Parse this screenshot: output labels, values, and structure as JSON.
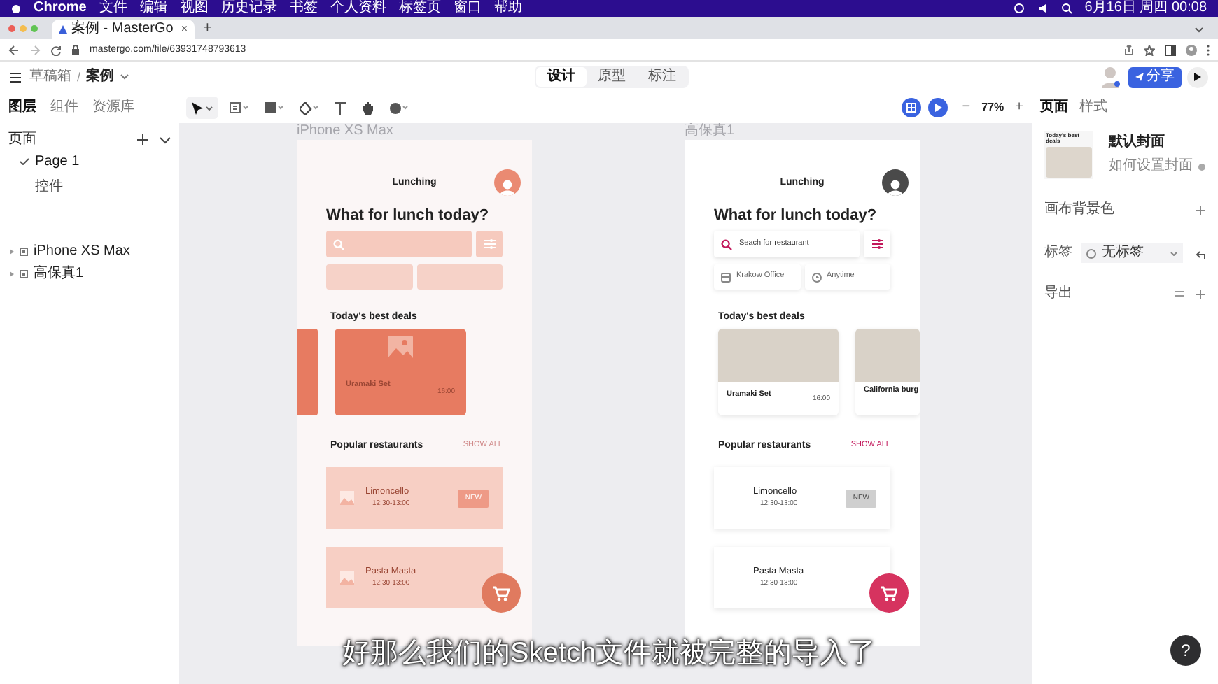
{
  "menubar": {
    "items": [
      "Chrome",
      "文件",
      "编辑",
      "视图",
      "历史记录",
      "书签",
      "个人资料",
      "标签页",
      "窗口",
      "帮助"
    ],
    "clock": "6月16日 周四 00:08"
  },
  "browser": {
    "tab_title": "案例 - MasterGo",
    "tab_close": "×",
    "new_tab": "+",
    "url": "mastergo.com/file/63931748793613"
  },
  "app_header": {
    "breadcrumb": [
      "草稿箱",
      "案例"
    ],
    "separator": "/",
    "modes": [
      {
        "label": "设计",
        "selected": true
      },
      {
        "label": "原型",
        "selected": false
      },
      {
        "label": "标注",
        "selected": false
      }
    ],
    "share": "分享"
  },
  "left_tabs": [
    {
      "label": "图层",
      "selected": true
    },
    {
      "label": "组件",
      "selected": false
    },
    {
      "label": "资源库",
      "selected": false
    }
  ],
  "zoom": {
    "minus": "−",
    "value": "77%",
    "plus": "+"
  },
  "right_tabs": [
    {
      "label": "页面",
      "selected": true
    },
    {
      "label": "样式",
      "selected": false
    }
  ],
  "pages": {
    "title": "页面",
    "items": [
      {
        "label": "Page 1",
        "selected": true
      },
      {
        "label": "控件",
        "selected": false
      }
    ]
  },
  "layers": [
    {
      "label": "iPhone XS Max"
    },
    {
      "label": "高保真1"
    }
  ],
  "frames": [
    {
      "label": "iPhone XS Max",
      "kind": "wireframe",
      "app_title": "Lunching",
      "heading": "What for lunch today?",
      "deals_title": "Today's best deals",
      "deals": [
        {
          "name": "Uramaki Set",
          "time": "16:00"
        }
      ],
      "popular_title": "Popular restaurants",
      "show_all": "SHOW ALL",
      "restaurants": [
        {
          "name": "Limoncello",
          "hours": "12:30-13:00",
          "badge": "NEW"
        },
        {
          "name": "Pasta Masta",
          "hours": "12:30-13:00"
        }
      ]
    },
    {
      "label": "高保真1",
      "kind": "hifi",
      "app_title": "Lunching",
      "heading": "What for lunch today?",
      "search_placeholder": "Seach for restaurant",
      "chips": [
        "Krakow Office",
        "Anytime"
      ],
      "deals_title": "Today's best deals",
      "deals": [
        {
          "name": "Uramaki Set",
          "time": "16:00"
        },
        {
          "name": "California burg"
        }
      ],
      "popular_title": "Popular restaurants",
      "show_all": "SHOW ALL",
      "restaurants": [
        {
          "name": "Limoncello",
          "hours": "12:30-13:00",
          "badge": "NEW"
        },
        {
          "name": "Pasta Masta",
          "hours": "12:30-13:00"
        }
      ]
    }
  ],
  "right_panel": {
    "cover_caption": "Today's best deals",
    "cover_title": "默认封面",
    "cover_link": "如何设置封面",
    "canvas_bg": "画布背景色",
    "tag_label": "标签",
    "tag_value": "无标签",
    "export": "导出"
  },
  "subtitle": "好那么我们的Sketch文件就被完整的导入了",
  "help": "?"
}
